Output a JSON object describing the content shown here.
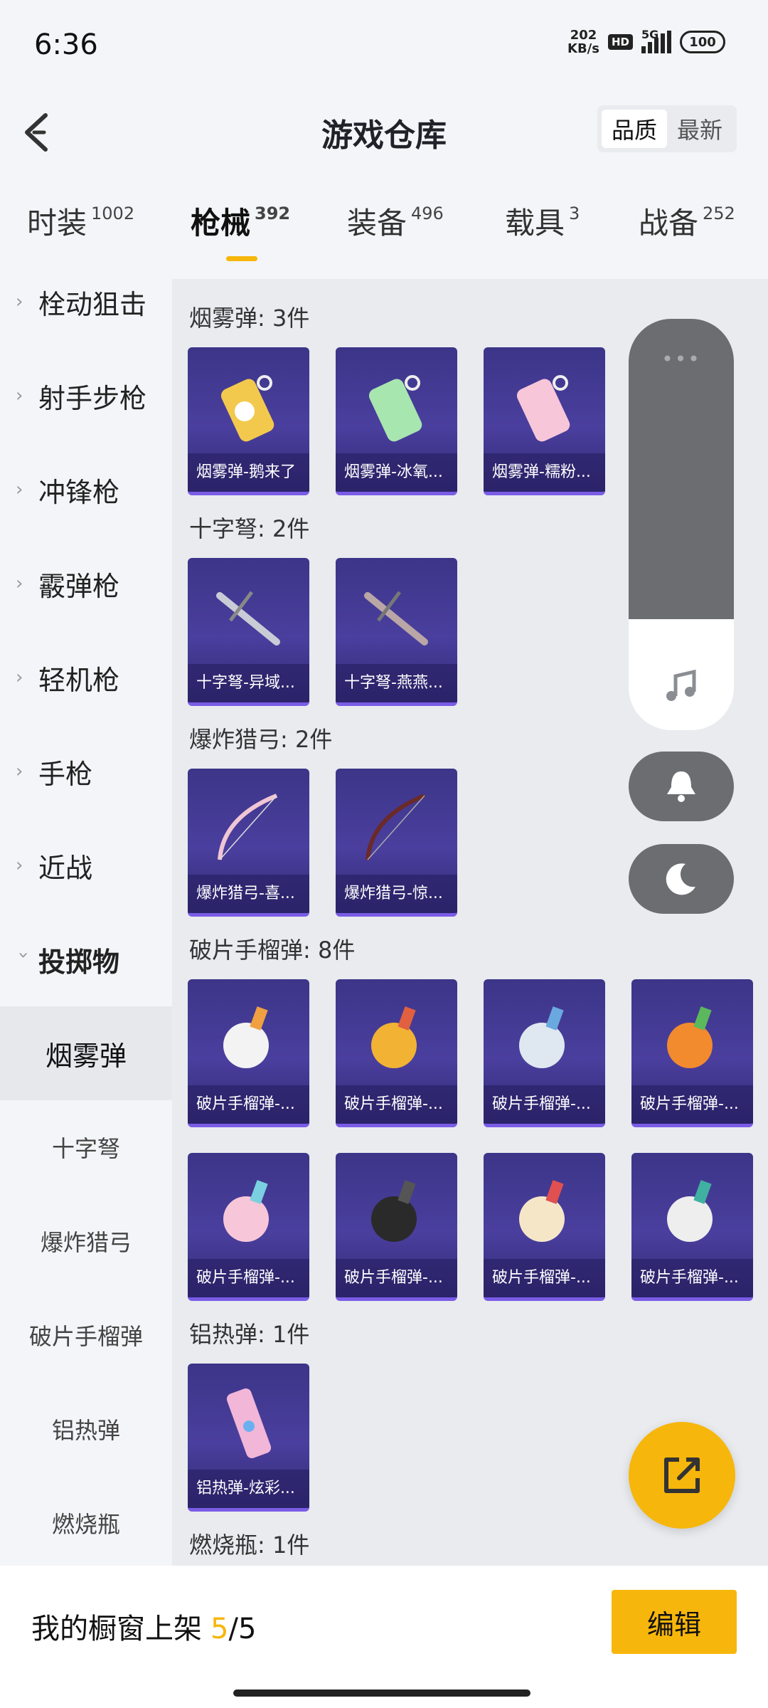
{
  "status_bar": {
    "time": "6:36",
    "net_speed_value": "202",
    "net_speed_unit": "KB/s",
    "hd": "HD",
    "network": "5G",
    "battery": "100"
  },
  "header": {
    "title": "游戏仓库",
    "sort_quality": "品质",
    "sort_latest": "最新"
  },
  "tabs": [
    {
      "label": "时装",
      "count": "1002"
    },
    {
      "label": "枪械",
      "count": "392"
    },
    {
      "label": "装备",
      "count": "496"
    },
    {
      "label": "载具",
      "count": "3"
    },
    {
      "label": "战备",
      "count": "252"
    }
  ],
  "sidebar": {
    "categories": [
      "栓动狙击",
      "射手步枪",
      "冲锋枪",
      "霰弹枪",
      "轻机枪",
      "手枪",
      "近战",
      "投掷物"
    ],
    "subcategories": [
      "烟雾弹",
      "十字弩",
      "爆炸猎弓",
      "破片手榴弹",
      "铝热弹",
      "燃烧瓶"
    ]
  },
  "sections": [
    {
      "title": "烟雾弹: 3件",
      "items": [
        "烟雾弹-鹅来了",
        "烟雾弹-冰氧...",
        "烟雾弹-糯粉..."
      ]
    },
    {
      "title": "十字弩: 2件",
      "items": [
        "十字弩-异域...",
        "十字弩-燕燕..."
      ]
    },
    {
      "title": "爆炸猎弓: 2件",
      "items": [
        "爆炸猎弓-喜...",
        "爆炸猎弓-惊..."
      ]
    },
    {
      "title": "破片手榴弹: 8件",
      "items": [
        "破片手榴弹-...",
        "破片手榴弹-...",
        "破片手榴弹-...",
        "破片手榴弹-...",
        "破片手榴弹-...",
        "破片手榴弹-...",
        "破片手榴弹-...",
        "破片手榴弹-..."
      ]
    },
    {
      "title": "铝热弹: 1件",
      "items": [
        "铝热弹-炫彩..."
      ]
    },
    {
      "title": "燃烧瓶: 1件",
      "items": []
    }
  ],
  "floating_panel": {
    "dots": "•••"
  },
  "footer": {
    "showcase_label": "我的橱窗上架",
    "showcase_count": "5",
    "showcase_sep": "/",
    "showcase_total": "5",
    "edit_label": "编辑"
  },
  "colors": {
    "accent": "#f6b60b",
    "card_bg": "#3c3588",
    "card_border": "#7a5ce6",
    "panel_grey": "#6b6d71"
  }
}
